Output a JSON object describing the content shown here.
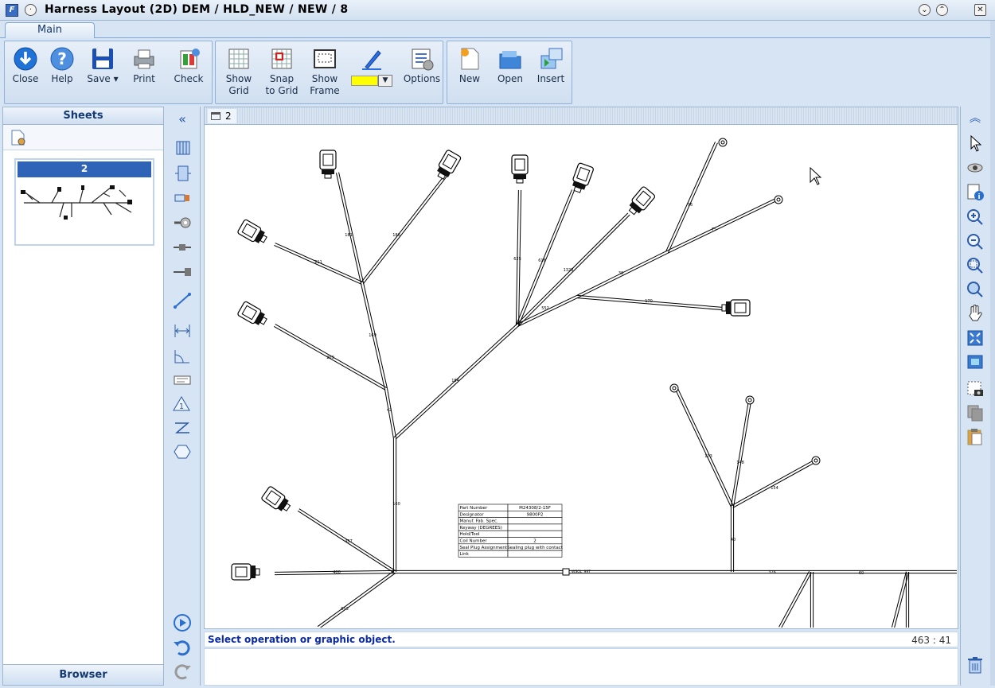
{
  "window": {
    "title": "Harness Layout (2D) DEM / HLD_NEW / NEW / 8",
    "min": "⌄",
    "max": "⌃",
    "close": "✕"
  },
  "tabs": [
    {
      "label": "Main"
    }
  ],
  "ribbon": {
    "close": "Close",
    "help": "Help",
    "save": "Save",
    "print": "Print",
    "check": "Check",
    "show_grid": [
      "Show",
      "Grid"
    ],
    "snap_to_grid": [
      "Snap",
      "to Grid"
    ],
    "show_frame": [
      "Show",
      "Frame"
    ],
    "color_swatch": "#ffff00",
    "options": "Options",
    "new": "New",
    "open": "Open",
    "insert": "Insert"
  },
  "sheets": {
    "header": "Sheets",
    "thumb_label": "2",
    "browser": "Browser"
  },
  "document": {
    "tab_label": "2"
  },
  "table": {
    "rows": [
      [
        "Part Number",
        "M24308/2-15F"
      ],
      [
        "Designator",
        "9800P2"
      ],
      [
        "Manuf. Fab. Spec.",
        ""
      ],
      [
        "Keyway (DEGREES)",
        ""
      ],
      [
        "Hold/Tool",
        ""
      ],
      [
        "Coil Number",
        "2"
      ],
      [
        "Seal Plug Assignment",
        "Sealing plug with contact"
      ],
      [
        "Link",
        ""
      ]
    ]
  },
  "segments": [
    "181",
    "186",
    "625",
    "616",
    "1328",
    "96",
    "75",
    "38",
    "552",
    "170",
    "211",
    "169",
    "184",
    "269",
    "42",
    "160",
    "437",
    "400",
    "653",
    "40",
    "173",
    "148",
    "154",
    "326",
    "60"
  ],
  "marker_label": "WSGL_99T",
  "status": {
    "message": "Select operation or graphic object.",
    "coords": "463 : 41"
  }
}
